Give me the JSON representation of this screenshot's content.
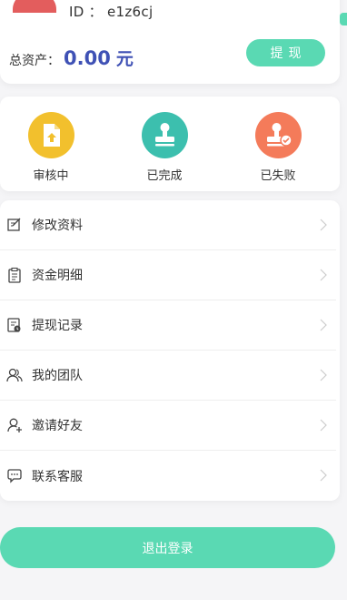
{
  "profile": {
    "id_label": "ID ： e1z6cj",
    "assets_label": "总资产：",
    "assets_value": "0.00",
    "assets_unit": "元",
    "withdraw_label": "提现"
  },
  "status": {
    "items": [
      {
        "label": "审核中",
        "color": "#f2c02d",
        "icon": "document-upload-icon"
      },
      {
        "label": "已完成",
        "color": "#3cbfae",
        "icon": "stamp-icon"
      },
      {
        "label": "已失败",
        "color": "#f47b5a",
        "icon": "stamp-check-icon"
      }
    ]
  },
  "menu": {
    "items": [
      {
        "label": "修改资料",
        "icon": "edit-icon"
      },
      {
        "label": "资金明细",
        "icon": "clipboard-icon"
      },
      {
        "label": "提现记录",
        "icon": "record-icon"
      },
      {
        "label": "我的团队",
        "icon": "team-icon"
      },
      {
        "label": "邀请好友",
        "icon": "invite-user-icon"
      },
      {
        "label": "联系客服",
        "icon": "chat-icon"
      }
    ]
  },
  "logout_label": "退出登录"
}
